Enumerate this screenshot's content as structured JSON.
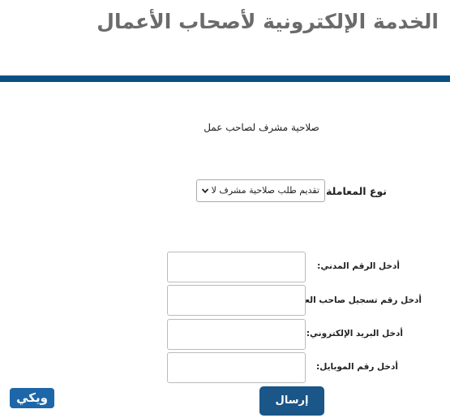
{
  "header": {
    "title": "الخدمة الإلكترونية لأصحاب الأعمال"
  },
  "service": {
    "name": "صلاحية مشرف لصاحب عمل"
  },
  "transaction": {
    "label": "نوع المعاملة:",
    "selected": "تقديم طلب صلاحية مشرف لا",
    "chevron_icon": "chevron-down-icon"
  },
  "form": {
    "civil_id_label": "أدخل الرقم المدني:",
    "civil_id_value": "",
    "employer_reg_label": "أدخل رقم تسجيل صاحب العمل:",
    "employer_reg_value": "",
    "email_label": "أدخل البريد الإلكتروني:",
    "email_value": "",
    "mobile_label": "أدخل رقم الموبايل:",
    "mobile_value": "",
    "submit_label": "إرسال"
  },
  "watermark": {
    "logo_text": "ويكي"
  },
  "colors": {
    "header_bar": "#0b4f82",
    "submit_bg": "#1a5688",
    "logo_bg": "#1d67a8",
    "title_text": "#6b6b6b"
  }
}
